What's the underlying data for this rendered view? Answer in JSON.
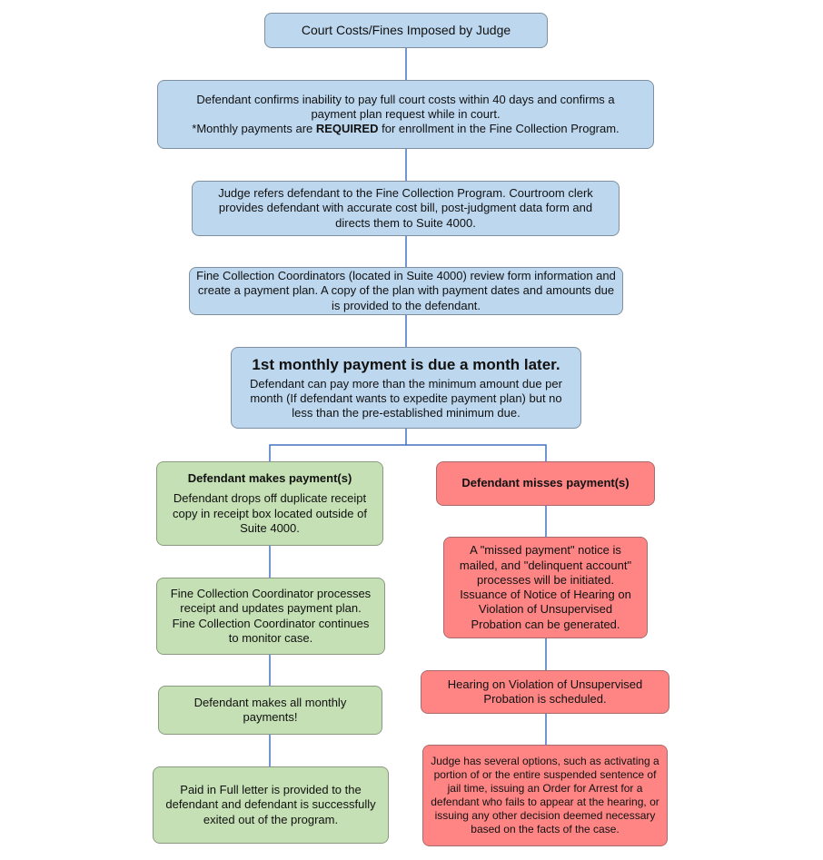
{
  "diagram": {
    "type": "flowchart",
    "colors": {
      "process_fill": "#bdd7ee",
      "success_fill": "#c5e0b4",
      "failure_fill": "#ff8585",
      "connector": "#4472c4"
    },
    "nodes": {
      "start": {
        "text": "Court Costs/Fines Imposed by Judge"
      },
      "confirm": {
        "line1": "Defendant confirms inability to pay full court costs within 40 days and confirms a payment plan request while in court.",
        "line2_prefix": "*Monthly payments are ",
        "line2_bold": "REQUIRED",
        "line2_suffix": " for enrollment in the Fine Collection Program."
      },
      "refer": {
        "text": "Judge refers  defendant to the Fine Collection Program.  Courtroom clerk provides defendant with accurate cost bill, post-judgment data form and directs them to Suite 4000."
      },
      "coordinators": {
        "text": "Fine Collection Coordinators (located in Suite 4000) review form information and create a payment plan. A copy of the plan with payment dates and amounts due is provided to the defendant."
      },
      "first_payment": {
        "title": "1st monthly payment is due a month later.",
        "text": "Defendant can pay more than the minimum amount due per month (If defendant wants to expedite payment plan) but no less than the pre-established minimum due."
      },
      "makes_payment": {
        "title": "Defendant makes payment(s)",
        "text": "Defendant drops off duplicate receipt copy in receipt box located outside of Suite 4000."
      },
      "processes_receipt": {
        "text": "Fine Collection Coordinator processes receipt and updates payment plan. Fine Collection Coordinator continues to monitor case."
      },
      "all_payments": {
        "text": "Defendant makes all monthly payments!"
      },
      "paid_in_full": {
        "text": "Paid in Full letter is provided to the defendant and defendant is successfully exited out of the program."
      },
      "misses_payment": {
        "title": "Defendant misses payment(s)"
      },
      "missed_notice": {
        "text": "A \"missed payment\" notice is mailed, and \"delinquent account\" processes will be initiated. Issuance of Notice of Hearing on Violation of Unsupervised Probation can be generated."
      },
      "hearing": {
        "text": "Hearing on Violation of Unsupervised Probation is scheduled."
      },
      "judge_options": {
        "text": "Judge has several options, such as activating a portion of or the entire suspended sentence of jail time, issuing an Order for Arrest for a defendant who fails to appear at the hearing, or issuing any other decision deemed necessary based on the facts of the case."
      }
    },
    "edges": [
      [
        "start",
        "confirm"
      ],
      [
        "confirm",
        "refer"
      ],
      [
        "refer",
        "coordinators"
      ],
      [
        "coordinators",
        "first_payment"
      ],
      [
        "first_payment",
        "makes_payment"
      ],
      [
        "first_payment",
        "misses_payment"
      ],
      [
        "makes_payment",
        "processes_receipt"
      ],
      [
        "processes_receipt",
        "all_payments"
      ],
      [
        "all_payments",
        "paid_in_full"
      ],
      [
        "misses_payment",
        "missed_notice"
      ],
      [
        "missed_notice",
        "hearing"
      ],
      [
        "hearing",
        "judge_options"
      ]
    ]
  }
}
